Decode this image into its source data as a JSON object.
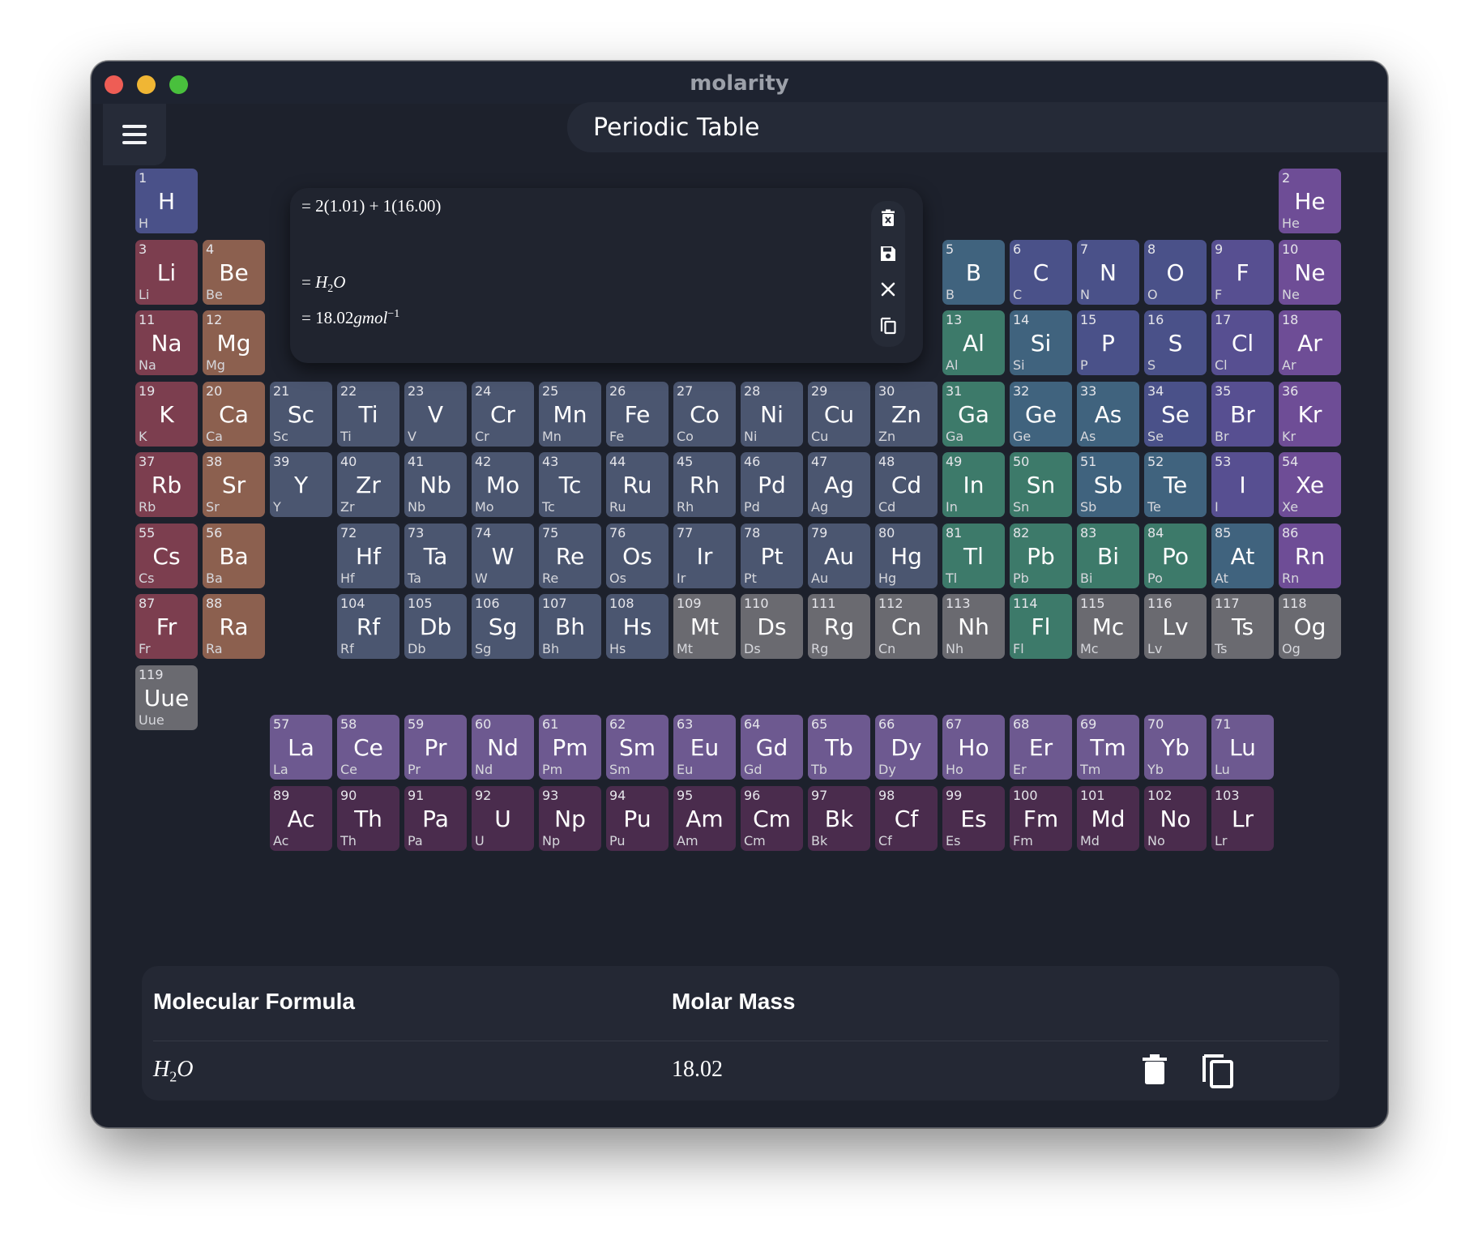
{
  "window": {
    "title": "molarity"
  },
  "header": {
    "page_title": "Periodic Table"
  },
  "calculator": {
    "line1_prefix": "= ",
    "line1_expr": "2(1.01) + 1(16.00)",
    "line2_prefix": "= ",
    "line2_formula_a": "H",
    "line2_formula_sub": "2",
    "line2_formula_b": "O",
    "line3_prefix": "= ",
    "line3_value": "18.02",
    "line3_unit": "gmol",
    "line3_exp": "−1"
  },
  "summary": {
    "col_formula": "Molecular Formula",
    "col_mass": "Molar Mass",
    "row_formula_a": "H",
    "row_formula_sub": "2",
    "row_formula_b": "O",
    "row_mass": "18.02"
  },
  "elements": [
    {
      "n": 1,
      "s": "H",
      "c": "nonmetal",
      "g": 1,
      "p": 1
    },
    {
      "n": 2,
      "s": "He",
      "c": "noble",
      "g": 18,
      "p": 1
    },
    {
      "n": 3,
      "s": "Li",
      "c": "alkali",
      "g": 1,
      "p": 2
    },
    {
      "n": 4,
      "s": "Be",
      "c": "alkaline",
      "g": 2,
      "p": 2
    },
    {
      "n": 5,
      "s": "B",
      "c": "metalloid",
      "g": 13,
      "p": 2
    },
    {
      "n": 6,
      "s": "C",
      "c": "nonmetal",
      "g": 14,
      "p": 2
    },
    {
      "n": 7,
      "s": "N",
      "c": "nonmetal",
      "g": 15,
      "p": 2
    },
    {
      "n": 8,
      "s": "O",
      "c": "nonmetal",
      "g": 16,
      "p": 2
    },
    {
      "n": 9,
      "s": "F",
      "c": "halogen",
      "g": 17,
      "p": 2
    },
    {
      "n": 10,
      "s": "Ne",
      "c": "noble",
      "g": 18,
      "p": 2
    },
    {
      "n": 11,
      "s": "Na",
      "c": "alkali",
      "g": 1,
      "p": 3
    },
    {
      "n": 12,
      "s": "Mg",
      "c": "alkaline",
      "g": 2,
      "p": 3
    },
    {
      "n": 13,
      "s": "Al",
      "c": "post",
      "g": 13,
      "p": 3
    },
    {
      "n": 14,
      "s": "Si",
      "c": "metalloid",
      "g": 14,
      "p": 3
    },
    {
      "n": 15,
      "s": "P",
      "c": "nonmetal",
      "g": 15,
      "p": 3
    },
    {
      "n": 16,
      "s": "S",
      "c": "nonmetal",
      "g": 16,
      "p": 3
    },
    {
      "n": 17,
      "s": "Cl",
      "c": "halogen",
      "g": 17,
      "p": 3
    },
    {
      "n": 18,
      "s": "Ar",
      "c": "noble",
      "g": 18,
      "p": 3
    },
    {
      "n": 19,
      "s": "K",
      "c": "alkali",
      "g": 1,
      "p": 4
    },
    {
      "n": 20,
      "s": "Ca",
      "c": "alkaline",
      "g": 2,
      "p": 4
    },
    {
      "n": 21,
      "s": "Sc",
      "c": "transition",
      "g": 3,
      "p": 4
    },
    {
      "n": 22,
      "s": "Ti",
      "c": "transition",
      "g": 4,
      "p": 4
    },
    {
      "n": 23,
      "s": "V",
      "c": "transition",
      "g": 5,
      "p": 4
    },
    {
      "n": 24,
      "s": "Cr",
      "c": "transition",
      "g": 6,
      "p": 4
    },
    {
      "n": 25,
      "s": "Mn",
      "c": "transition",
      "g": 7,
      "p": 4
    },
    {
      "n": 26,
      "s": "Fe",
      "c": "transition",
      "g": 8,
      "p": 4
    },
    {
      "n": 27,
      "s": "Co",
      "c": "transition",
      "g": 9,
      "p": 4
    },
    {
      "n": 28,
      "s": "Ni",
      "c": "transition",
      "g": 10,
      "p": 4
    },
    {
      "n": 29,
      "s": "Cu",
      "c": "transition",
      "g": 11,
      "p": 4
    },
    {
      "n": 30,
      "s": "Zn",
      "c": "transition",
      "g": 12,
      "p": 4
    },
    {
      "n": 31,
      "s": "Ga",
      "c": "post",
      "g": 13,
      "p": 4
    },
    {
      "n": 32,
      "s": "Ge",
      "c": "metalloid",
      "g": 14,
      "p": 4
    },
    {
      "n": 33,
      "s": "As",
      "c": "metalloid",
      "g": 15,
      "p": 4
    },
    {
      "n": 34,
      "s": "Se",
      "c": "nonmetal",
      "g": 16,
      "p": 4
    },
    {
      "n": 35,
      "s": "Br",
      "c": "halogen",
      "g": 17,
      "p": 4
    },
    {
      "n": 36,
      "s": "Kr",
      "c": "noble",
      "g": 18,
      "p": 4
    },
    {
      "n": 37,
      "s": "Rb",
      "c": "alkali",
      "g": 1,
      "p": 5
    },
    {
      "n": 38,
      "s": "Sr",
      "c": "alkaline",
      "g": 2,
      "p": 5
    },
    {
      "n": 39,
      "s": "Y",
      "c": "transition",
      "g": 3,
      "p": 5
    },
    {
      "n": 40,
      "s": "Zr",
      "c": "transition",
      "g": 4,
      "p": 5
    },
    {
      "n": 41,
      "s": "Nb",
      "c": "transition",
      "g": 5,
      "p": 5
    },
    {
      "n": 42,
      "s": "Mo",
      "c": "transition",
      "g": 6,
      "p": 5
    },
    {
      "n": 43,
      "s": "Tc",
      "c": "transition",
      "g": 7,
      "p": 5
    },
    {
      "n": 44,
      "s": "Ru",
      "c": "transition",
      "g": 8,
      "p": 5
    },
    {
      "n": 45,
      "s": "Rh",
      "c": "transition",
      "g": 9,
      "p": 5
    },
    {
      "n": 46,
      "s": "Pd",
      "c": "transition",
      "g": 10,
      "p": 5
    },
    {
      "n": 47,
      "s": "Ag",
      "c": "transition",
      "g": 11,
      "p": 5
    },
    {
      "n": 48,
      "s": "Cd",
      "c": "transition",
      "g": 12,
      "p": 5
    },
    {
      "n": 49,
      "s": "In",
      "c": "post",
      "g": 13,
      "p": 5
    },
    {
      "n": 50,
      "s": "Sn",
      "c": "post",
      "g": 14,
      "p": 5
    },
    {
      "n": 51,
      "s": "Sb",
      "c": "metalloid",
      "g": 15,
      "p": 5
    },
    {
      "n": 52,
      "s": "Te",
      "c": "metalloid",
      "g": 16,
      "p": 5
    },
    {
      "n": 53,
      "s": "I",
      "c": "halogen",
      "g": 17,
      "p": 5
    },
    {
      "n": 54,
      "s": "Xe",
      "c": "noble",
      "g": 18,
      "p": 5
    },
    {
      "n": 55,
      "s": "Cs",
      "c": "alkali",
      "g": 1,
      "p": 6
    },
    {
      "n": 56,
      "s": "Ba",
      "c": "alkaline",
      "g": 2,
      "p": 6
    },
    {
      "n": 72,
      "s": "Hf",
      "c": "transition",
      "g": 4,
      "p": 6
    },
    {
      "n": 73,
      "s": "Ta",
      "c": "transition",
      "g": 5,
      "p": 6
    },
    {
      "n": 74,
      "s": "W",
      "c": "transition",
      "g": 6,
      "p": 6
    },
    {
      "n": 75,
      "s": "Re",
      "c": "transition",
      "g": 7,
      "p": 6
    },
    {
      "n": 76,
      "s": "Os",
      "c": "transition",
      "g": 8,
      "p": 6
    },
    {
      "n": 77,
      "s": "Ir",
      "c": "transition",
      "g": 9,
      "p": 6
    },
    {
      "n": 78,
      "s": "Pt",
      "c": "transition",
      "g": 10,
      "p": 6
    },
    {
      "n": 79,
      "s": "Au",
      "c": "transition",
      "g": 11,
      "p": 6
    },
    {
      "n": 80,
      "s": "Hg",
      "c": "transition",
      "g": 12,
      "p": 6
    },
    {
      "n": 81,
      "s": "Tl",
      "c": "post",
      "g": 13,
      "p": 6
    },
    {
      "n": 82,
      "s": "Pb",
      "c": "post",
      "g": 14,
      "p": 6
    },
    {
      "n": 83,
      "s": "Bi",
      "c": "post",
      "g": 15,
      "p": 6
    },
    {
      "n": 84,
      "s": "Po",
      "c": "post",
      "g": 16,
      "p": 6
    },
    {
      "n": 85,
      "s": "At",
      "c": "metalloid",
      "g": 17,
      "p": 6
    },
    {
      "n": 86,
      "s": "Rn",
      "c": "noble",
      "g": 18,
      "p": 6
    },
    {
      "n": 87,
      "s": "Fr",
      "c": "alkali",
      "g": 1,
      "p": 7
    },
    {
      "n": 88,
      "s": "Ra",
      "c": "alkaline",
      "g": 2,
      "p": 7
    },
    {
      "n": 104,
      "s": "Rf",
      "c": "transition",
      "g": 4,
      "p": 7
    },
    {
      "n": 105,
      "s": "Db",
      "c": "transition",
      "g": 5,
      "p": 7
    },
    {
      "n": 106,
      "s": "Sg",
      "c": "transition",
      "g": 6,
      "p": 7
    },
    {
      "n": 107,
      "s": "Bh",
      "c": "transition",
      "g": 7,
      "p": 7
    },
    {
      "n": 108,
      "s": "Hs",
      "c": "transition",
      "g": 8,
      "p": 7
    },
    {
      "n": 109,
      "s": "Mt",
      "c": "unknown",
      "g": 9,
      "p": 7
    },
    {
      "n": 110,
      "s": "Ds",
      "c": "unknown",
      "g": 10,
      "p": 7
    },
    {
      "n": 111,
      "s": "Rg",
      "c": "unknown",
      "g": 11,
      "p": 7
    },
    {
      "n": 112,
      "s": "Cn",
      "c": "unknown",
      "g": 12,
      "p": 7
    },
    {
      "n": 113,
      "s": "Nh",
      "c": "unknown",
      "g": 13,
      "p": 7
    },
    {
      "n": 114,
      "s": "Fl",
      "c": "post",
      "g": 14,
      "p": 7
    },
    {
      "n": 115,
      "s": "Mc",
      "c": "unknown",
      "g": 15,
      "p": 7
    },
    {
      "n": 116,
      "s": "Lv",
      "c": "unknown",
      "g": 16,
      "p": 7
    },
    {
      "n": 117,
      "s": "Ts",
      "c": "unknown",
      "g": 17,
      "p": 7
    },
    {
      "n": 118,
      "s": "Og",
      "c": "unknown",
      "g": 18,
      "p": 7
    },
    {
      "n": 119,
      "s": "Uue",
      "c": "unknown",
      "g": 1,
      "p": 8
    },
    {
      "n": 57,
      "s": "La",
      "c": "lanth",
      "g": 3,
      "p": 9
    },
    {
      "n": 58,
      "s": "Ce",
      "c": "lanth",
      "g": 4,
      "p": 9
    },
    {
      "n": 59,
      "s": "Pr",
      "c": "lanth",
      "g": 5,
      "p": 9
    },
    {
      "n": 60,
      "s": "Nd",
      "c": "lanth",
      "g": 6,
      "p": 9
    },
    {
      "n": 61,
      "s": "Pm",
      "c": "lanth",
      "g": 7,
      "p": 9
    },
    {
      "n": 62,
      "s": "Sm",
      "c": "lanth",
      "g": 8,
      "p": 9
    },
    {
      "n": 63,
      "s": "Eu",
      "c": "lanth",
      "g": 9,
      "p": 9
    },
    {
      "n": 64,
      "s": "Gd",
      "c": "lanth",
      "g": 10,
      "p": 9
    },
    {
      "n": 65,
      "s": "Tb",
      "c": "lanth",
      "g": 11,
      "p": 9
    },
    {
      "n": 66,
      "s": "Dy",
      "c": "lanth",
      "g": 12,
      "p": 9
    },
    {
      "n": 67,
      "s": "Ho",
      "c": "lanth",
      "g": 13,
      "p": 9
    },
    {
      "n": 68,
      "s": "Er",
      "c": "lanth",
      "g": 14,
      "p": 9
    },
    {
      "n": 69,
      "s": "Tm",
      "c": "lanth",
      "g": 15,
      "p": 9
    },
    {
      "n": 70,
      "s": "Yb",
      "c": "lanth",
      "g": 16,
      "p": 9
    },
    {
      "n": 71,
      "s": "Lu",
      "c": "lanth",
      "g": 17,
      "p": 9
    },
    {
      "n": 89,
      "s": "Ac",
      "c": "actin",
      "g": 3,
      "p": 10
    },
    {
      "n": 90,
      "s": "Th",
      "c": "actin",
      "g": 4,
      "p": 10
    },
    {
      "n": 91,
      "s": "Pa",
      "c": "actin",
      "g": 5,
      "p": 10
    },
    {
      "n": 92,
      "s": "U",
      "c": "actin",
      "g": 6,
      "p": 10
    },
    {
      "n": 93,
      "s": "Np",
      "c": "actin",
      "g": 7,
      "p": 10
    },
    {
      "n": 94,
      "s": "Pu",
      "c": "actin",
      "g": 8,
      "p": 10
    },
    {
      "n": 95,
      "s": "Am",
      "c": "actin",
      "g": 9,
      "p": 10
    },
    {
      "n": 96,
      "s": "Cm",
      "c": "actin",
      "g": 10,
      "p": 10
    },
    {
      "n": 97,
      "s": "Bk",
      "c": "actin",
      "g": 11,
      "p": 10
    },
    {
      "n": 98,
      "s": "Cf",
      "c": "actin",
      "g": 12,
      "p": 10
    },
    {
      "n": 99,
      "s": "Es",
      "c": "actin",
      "g": 13,
      "p": 10
    },
    {
      "n": 100,
      "s": "Fm",
      "c": "actin",
      "g": 14,
      "p": 10
    },
    {
      "n": 101,
      "s": "Md",
      "c": "actin",
      "g": 15,
      "p": 10
    },
    {
      "n": 102,
      "s": "No",
      "c": "actin",
      "g": 16,
      "p": 10
    },
    {
      "n": 103,
      "s": "Lr",
      "c": "actin",
      "g": 17,
      "p": 10
    }
  ]
}
